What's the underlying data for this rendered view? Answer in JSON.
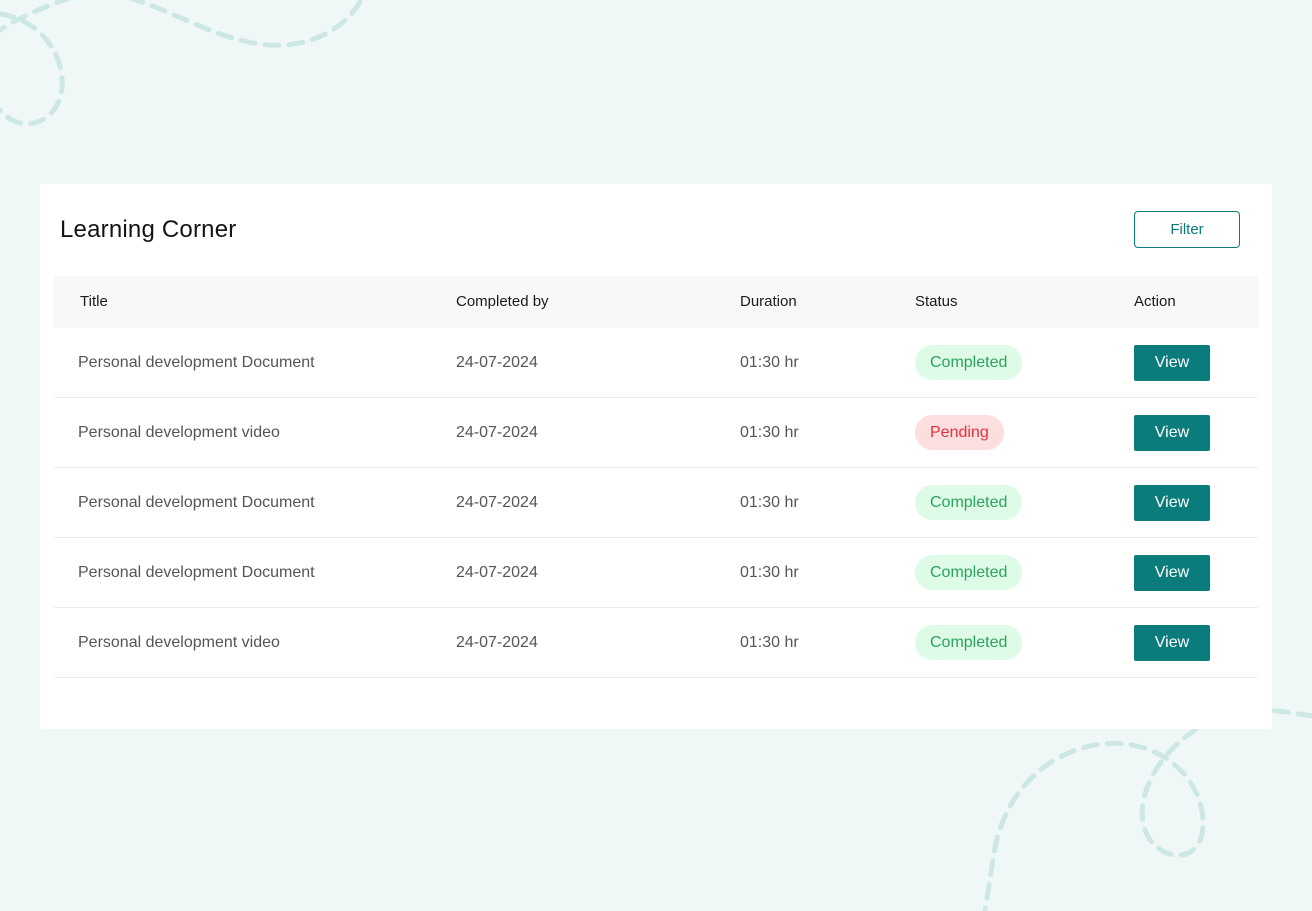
{
  "page": {
    "title": "Learning Corner",
    "filter_label": "Filter"
  },
  "table": {
    "headers": {
      "title": "Title",
      "completed_by": "Completed by",
      "duration": "Duration",
      "status": "Status",
      "action": "Action"
    },
    "rows": [
      {
        "title": "Personal development Document",
        "completed_by": "24-07-2024",
        "duration": "01:30 hr",
        "status": "Completed",
        "status_type": "completed",
        "action": "View"
      },
      {
        "title": "Personal development video",
        "completed_by": "24-07-2024",
        "duration": "01:30 hr",
        "status": "Pending",
        "status_type": "pending",
        "action": "View"
      },
      {
        "title": "Personal development Document",
        "completed_by": "24-07-2024",
        "duration": "01:30 hr",
        "status": "Completed",
        "status_type": "completed",
        "action": "View"
      },
      {
        "title": "Personal development Document",
        "completed_by": "24-07-2024",
        "duration": "01:30 hr",
        "status": "Completed",
        "status_type": "completed",
        "action": "View"
      },
      {
        "title": "Personal development video",
        "completed_by": "24-07-2024",
        "duration": "01:30 hr",
        "status": "Completed",
        "status_type": "completed",
        "action": "View"
      }
    ]
  },
  "colors": {
    "background": "#eff8f6",
    "accent": "#0a7c7b",
    "completed_bg": "#defbe8",
    "completed_text": "#2ca35c",
    "pending_bg": "#fddede",
    "pending_text": "#e2333a",
    "decoration": "#cde8e4"
  }
}
